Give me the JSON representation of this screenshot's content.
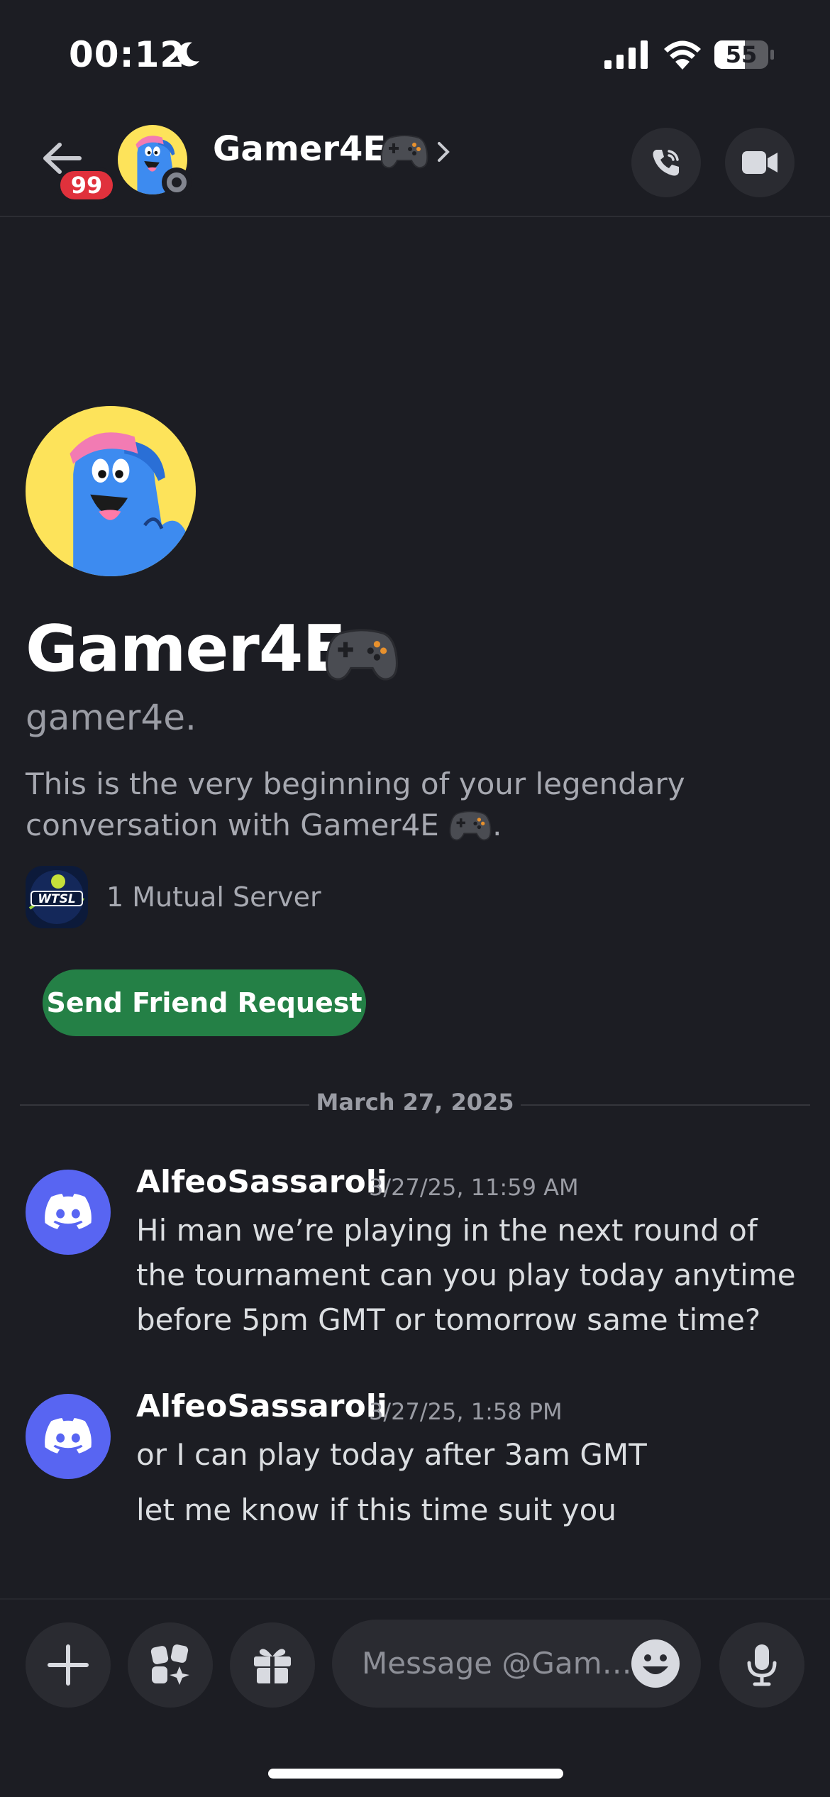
{
  "status_bar": {
    "time": "00:12",
    "battery": "55"
  },
  "header": {
    "back_badge": "99",
    "name": "Gamer4E",
    "name_emoji": "game-controller-icon",
    "call_icon": "phone-icon",
    "video_icon": "video-camera-icon"
  },
  "profile": {
    "display_name": "Gamer4E",
    "username": "gamer4e.",
    "intro": "This is the very beginning of your legendary conversation with Gamer4E",
    "intro_suffix": ".",
    "mutual_servers": "1 Mutual Server",
    "server_logo_text": "WTSL",
    "friend_button": "Send Friend Request"
  },
  "divider": {
    "date": "March 27, 2025"
  },
  "messages": [
    {
      "author": "AlfeoSassaroli",
      "timestamp": "3/27/25, 11:59 AM",
      "lines": [
        "Hi man we’re playing in the next round of the tournament can you play today anytime before 5pm GMT or tomorrow same time?"
      ]
    },
    {
      "author": "AlfeoSassaroli",
      "timestamp": "3/27/25, 1:58 PM",
      "lines": [
        "or I can play today after 3am GMT",
        "let me know if this time suit you"
      ]
    }
  ],
  "composer": {
    "placeholder": "Message @Gam…",
    "add_icon": "plus-icon",
    "apps_icon": "apps-icon",
    "gift_icon": "gift-icon",
    "emoji_icon": "emoji-icon",
    "mic_icon": "microphone-icon"
  },
  "colors": {
    "background": "#1c1d23",
    "blurple": "#5865f2",
    "green": "#248046",
    "badge_red": "#e0313c"
  }
}
